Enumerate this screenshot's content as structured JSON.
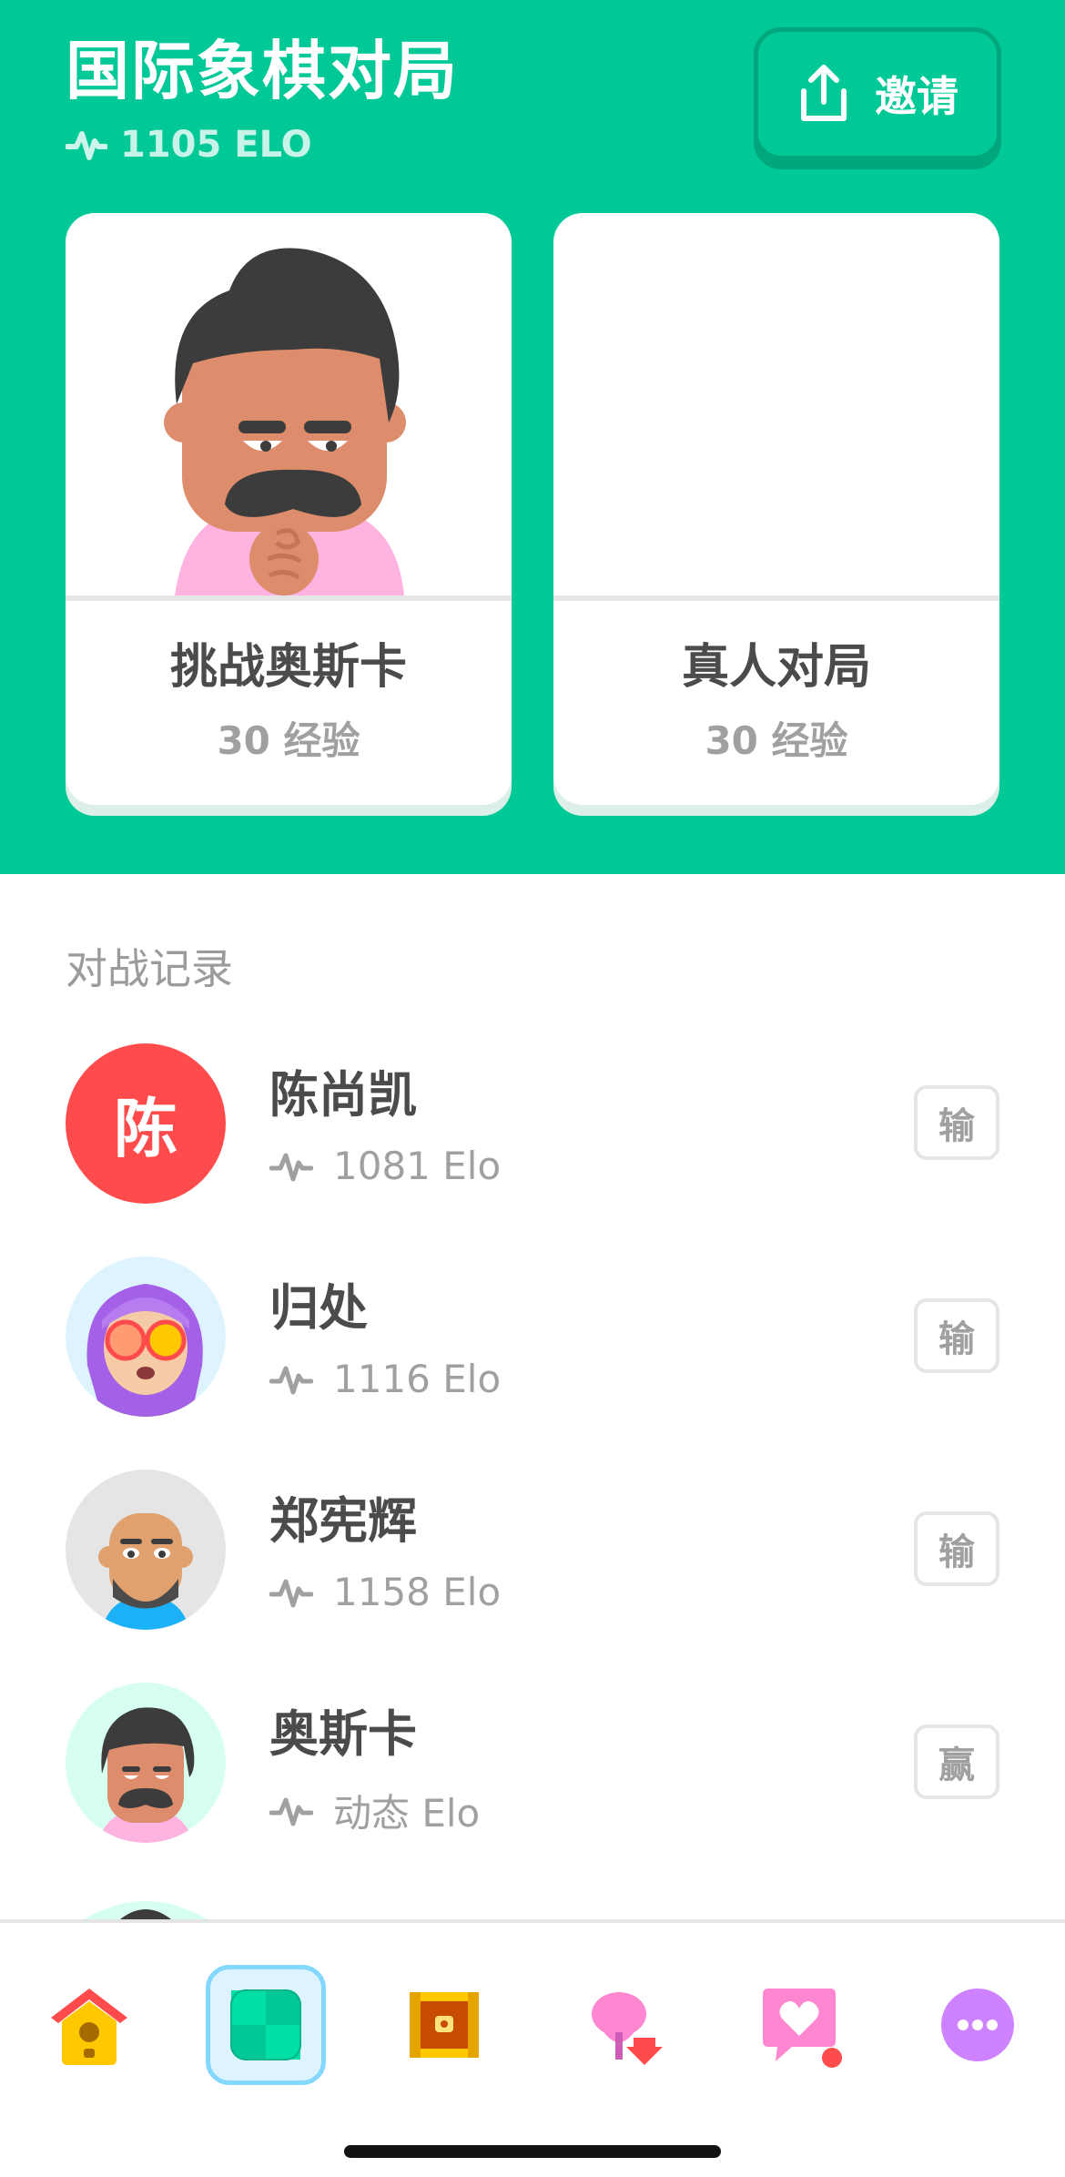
{
  "header": {
    "title": "国际象棋对局",
    "elo": "1105 ELO",
    "invite_label": "邀请"
  },
  "modes": [
    {
      "label": "挑战奥斯卡",
      "xp": "30 经验"
    },
    {
      "label": "真人对局",
      "xp": "30 经验"
    }
  ],
  "history": {
    "title": "对战记录",
    "items": [
      {
        "name": "陈尚凯",
        "avatar_letter": "陈",
        "elo": "1081 Elo",
        "result": "输"
      },
      {
        "name": "归处",
        "elo": "1116 Elo",
        "result": "输"
      },
      {
        "name": "郑宪辉",
        "elo": "1158 Elo",
        "result": "输"
      },
      {
        "name": "奥斯卡",
        "elo": "动态 Elo",
        "result": "赢"
      }
    ]
  },
  "colors": {
    "brand_green": "#00C896",
    "loss_avatar_red": "#FF4B4B",
    "active_tab_bg": "#DDF4FF"
  },
  "nav": {
    "items": [
      {
        "icon": "home-birdhouse-icon"
      },
      {
        "icon": "chess-board-icon",
        "active": true
      },
      {
        "icon": "treasure-chest-icon"
      },
      {
        "icon": "friends-gift-icon"
      },
      {
        "icon": "heart-message-icon",
        "badge": true
      },
      {
        "icon": "more-options-icon"
      }
    ]
  }
}
